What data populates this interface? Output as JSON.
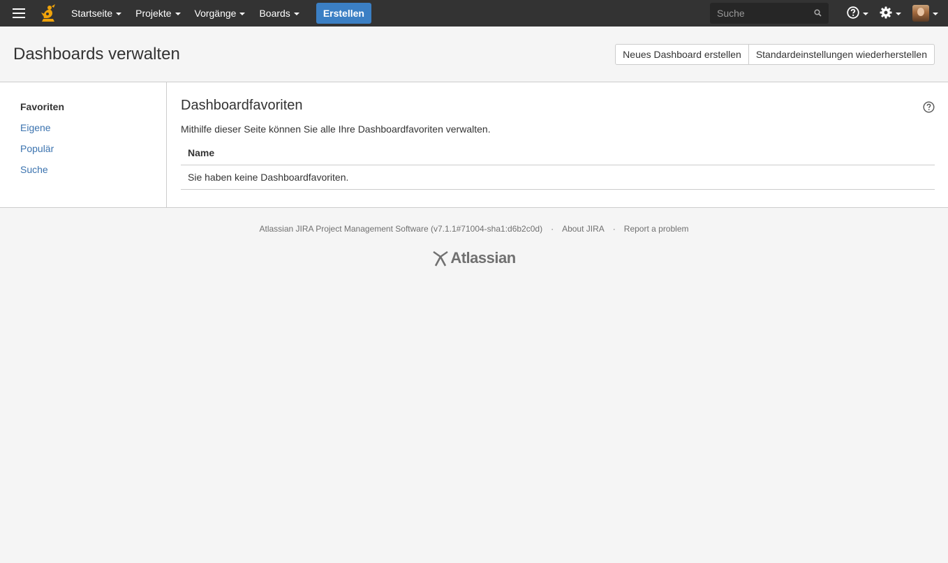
{
  "nav": {
    "items": [
      {
        "label": "Startseite"
      },
      {
        "label": "Projekte"
      },
      {
        "label": "Vorgänge"
      },
      {
        "label": "Boards"
      }
    ],
    "create_label": "Erstellen",
    "search_placeholder": "Suche"
  },
  "header": {
    "title": "Dashboards verwalten",
    "new_dashboard_label": "Neues Dashboard erstellen",
    "restore_defaults_label": "Standardeinstellungen wiederherstellen"
  },
  "sidebar": {
    "items": [
      {
        "label": "Favoriten"
      },
      {
        "label": "Eigene"
      },
      {
        "label": "Populär"
      },
      {
        "label": "Suche"
      }
    ]
  },
  "main": {
    "title": "Dashboardfavoriten",
    "description": "Mithilfe dieser Seite können Sie alle Ihre Dashboardfavoriten verwalten.",
    "table": {
      "column_name": "Name",
      "empty_message": "Sie haben keine Dashboardfavoriten."
    }
  },
  "footer": {
    "software_text": "Atlassian JIRA Project Management Software (v7.1.1#71004-sha1:d6b2c0d)",
    "separator": "·",
    "about_label": "About JIRA",
    "report_label": "Report a problem",
    "logo_text": "Atlassian"
  },
  "colors": {
    "nav_bg": "#333333",
    "create_button": "#3b7fc4",
    "link": "#3b73af",
    "logo_orange": "#f0a30a"
  }
}
